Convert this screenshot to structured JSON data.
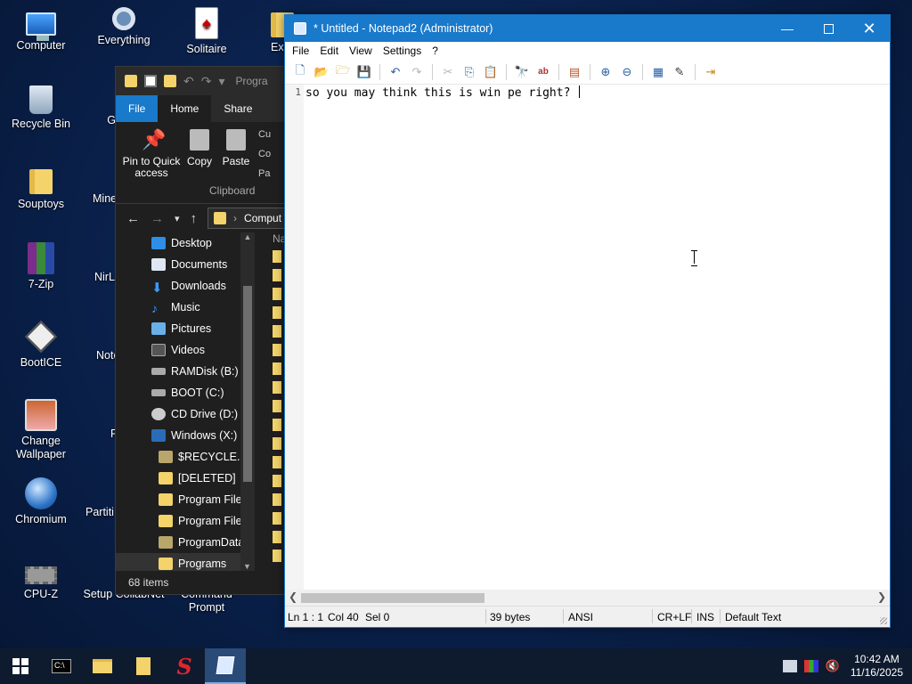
{
  "desktop": {
    "icons": [
      {
        "label": "Computer",
        "icon": "computer-icon"
      },
      {
        "label": "Everything",
        "icon": "search-magnifier-icon"
      },
      {
        "label": "Solitaire",
        "icon": "cards-icon"
      },
      {
        "label": "Exp",
        "icon": "explorer-icon"
      },
      {
        "label": "Recycle Bin",
        "icon": "recycle-bin-icon"
      },
      {
        "label": "G",
        "icon": "app-icon"
      },
      {
        "label": "Souptoys",
        "icon": "folder-icon"
      },
      {
        "label": "Mine",
        "icon": "app-icon"
      },
      {
        "label": "7-Zip",
        "icon": "archive-icon"
      },
      {
        "label": "NirL",
        "icon": "app-icon"
      },
      {
        "label": "BootICE",
        "icon": "bootice-icon"
      },
      {
        "label": "Note",
        "icon": "app-icon"
      },
      {
        "label": "Change Wallpaper",
        "icon": "wallpaper-icon"
      },
      {
        "label": "F",
        "icon": "app-icon"
      },
      {
        "label": "Chromium",
        "icon": "chromium-icon"
      },
      {
        "label": "Partiti",
        "icon": "partition-icon"
      },
      {
        "label": "CPU-Z",
        "icon": "cpu-icon"
      },
      {
        "label": "Setup CollabNet",
        "icon": "setup-icon"
      },
      {
        "label": "Command Prompt",
        "icon": "cmd-icon"
      }
    ]
  },
  "explorer": {
    "title_partial": "Progra",
    "tabs": {
      "file": "File",
      "home": "Home",
      "share": "Share"
    },
    "ribbon": {
      "pin": "Pin to Quick access",
      "copy": "Copy",
      "paste": "Paste",
      "small": [
        "Cu",
        "Co",
        "Pa"
      ],
      "group": "Clipboard"
    },
    "address_partial": "Comput",
    "tree": [
      {
        "label": "Desktop",
        "icon": "ti-blue",
        "indent": 1
      },
      {
        "label": "Documents",
        "icon": "ti-doc",
        "indent": 1
      },
      {
        "label": "Downloads",
        "icon": "ti-down",
        "indent": 1
      },
      {
        "label": "Music",
        "icon": "ti-music",
        "indent": 1
      },
      {
        "label": "Pictures",
        "icon": "ti-pic",
        "indent": 1
      },
      {
        "label": "Videos",
        "icon": "ti-vid",
        "indent": 1
      },
      {
        "label": "RAMDisk (B:)",
        "icon": "ti-drive",
        "indent": 1
      },
      {
        "label": "BOOT (C:)",
        "icon": "ti-drive",
        "indent": 1
      },
      {
        "label": "CD Drive (D:) H",
        "icon": "ti-cd",
        "indent": 1
      },
      {
        "label": "Windows (X:)",
        "icon": "ti-win",
        "indent": 1
      },
      {
        "label": "$RECYCLE.BIN",
        "icon": "ti-folder-dim",
        "indent": 2
      },
      {
        "label": "[DELETED]",
        "icon": "ti-folder",
        "indent": 2
      },
      {
        "label": "Program Files",
        "icon": "ti-folder",
        "indent": 2
      },
      {
        "label": "Program Files",
        "icon": "ti-folder",
        "indent": 2
      },
      {
        "label": "ProgramData",
        "icon": "ti-folder-dim",
        "indent": 2
      },
      {
        "label": "Programs",
        "icon": "ti-folder",
        "indent": 2,
        "selected": true
      }
    ],
    "column_header": "Na",
    "status": "68 items"
  },
  "notepad": {
    "title": "* Untitled - Notepad2 (Administrator)",
    "menu": [
      "File",
      "Edit",
      "View",
      "Settings",
      "?"
    ],
    "line_number": "1",
    "text": "so you may think this is win pe right? ",
    "status": {
      "position": "Ln 1 : 1",
      "col": "Col 40",
      "sel": "Sel 0",
      "bytes": "39 bytes",
      "encoding": "ANSI",
      "eol": "CR+LF",
      "mode": "INS",
      "scheme": "Default Text"
    }
  },
  "taskbar": {
    "clock_time": "10:42 AM",
    "clock_date": "11/16/2025",
    "accent": "#1979ca"
  }
}
